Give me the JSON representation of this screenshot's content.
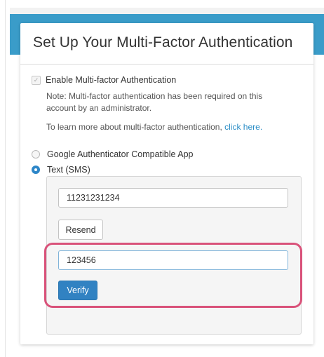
{
  "dialog": {
    "title": "Set Up Your Multi-Factor Authentication"
  },
  "mfa": {
    "enable_label": "Enable Multi-factor Authentication",
    "enable_checked": true,
    "note": "Note: Multi-factor authentication has been required on this account by an administrator.",
    "learn_prefix": "To learn more about multi-factor authentication, ",
    "learn_link": "click here."
  },
  "methods": {
    "options": [
      {
        "label": "Google Authenticator Compatible App",
        "selected": false
      },
      {
        "label": "Text (SMS)",
        "selected": true
      }
    ]
  },
  "sms": {
    "phone_value": "11231231234",
    "resend_label": "Resend",
    "code_value": "123456",
    "verify_label": "Verify"
  },
  "colors": {
    "header_bar": "#3a9cc9",
    "link": "#2a8dc6",
    "primary_button": "#3182c2",
    "highlight": "#d9527a"
  }
}
